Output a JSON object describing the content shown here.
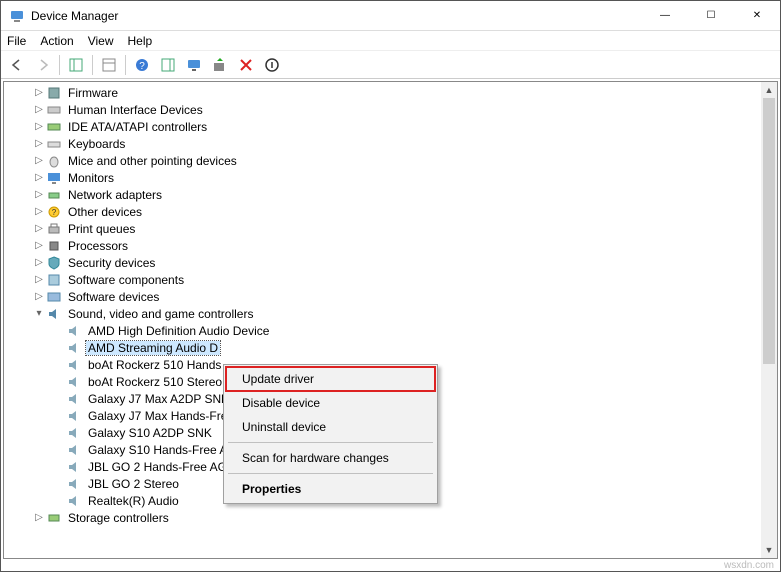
{
  "window": {
    "title": "Device Manager",
    "min": "—",
    "max": "☐",
    "close": "✕"
  },
  "menu": {
    "file": "File",
    "action": "Action",
    "view": "View",
    "help": "Help"
  },
  "tree": {
    "firmware": "Firmware",
    "hid": "Human Interface Devices",
    "ide": "IDE ATA/ATAPI controllers",
    "keyboards": "Keyboards",
    "mice": "Mice and other pointing devices",
    "monitors": "Monitors",
    "network": "Network adapters",
    "other": "Other devices",
    "printq": "Print queues",
    "processors": "Processors",
    "security": "Security devices",
    "swcomp": "Software components",
    "swdev": "Software devices",
    "sound": "Sound, video and game controllers",
    "storage": "Storage controllers",
    "snd": {
      "amd_hd": "AMD High Definition Audio Device",
      "amd_stream": "AMD Streaming Audio D",
      "boat_hands": "boAt Rockerz 510 Hands",
      "boat_stereo": "boAt Rockerz 510 Stereo",
      "j7_a2dp": "Galaxy J7 Max A2DP SNk",
      "j7_hands": "Galaxy J7 Max Hands-Fre",
      "s10_a2dp": "Galaxy S10 A2DP SNK",
      "s10_hands": "Galaxy S10 Hands-Free A",
      "jbl_hands": "JBL GO 2 Hands-Free AG",
      "jbl_stereo": "JBL GO 2 Stereo",
      "realtek": "Realtek(R) Audio"
    }
  },
  "context": {
    "update": "Update driver",
    "disable": "Disable device",
    "uninstall": "Uninstall device",
    "scan": "Scan for hardware changes",
    "properties": "Properties"
  },
  "watermark": "wsxdn.com"
}
